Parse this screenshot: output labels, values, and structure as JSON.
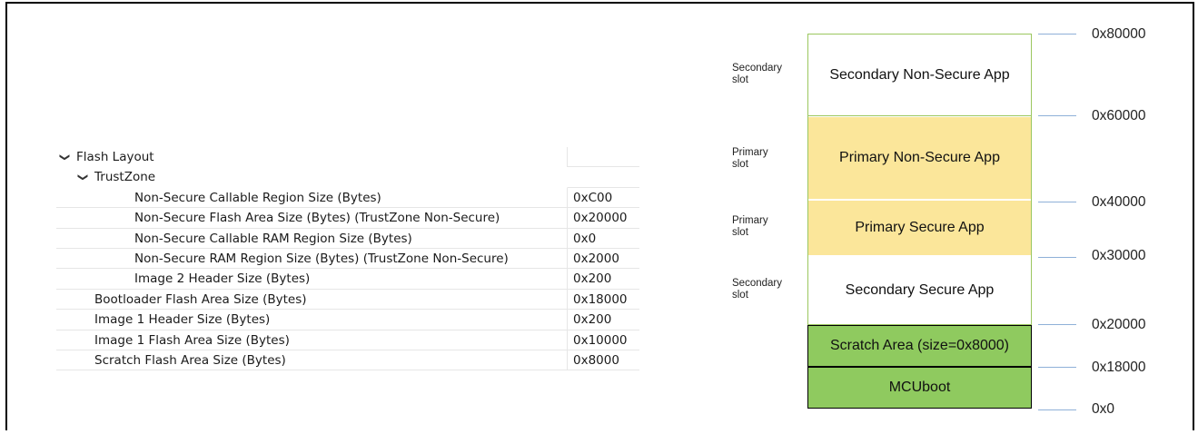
{
  "tree": {
    "flash_layout": "Flash Layout",
    "trustzone": "TrustZone",
    "rows": [
      {
        "name": "Non-Secure Callable Region Size (Bytes)",
        "value": "0xC00"
      },
      {
        "name": "Non-Secure Flash Area Size (Bytes) (TrustZone Non-Secure)",
        "value": "0x20000"
      },
      {
        "name": "Non-Secure Callable RAM Region Size (Bytes)",
        "value": "0x0"
      },
      {
        "name": "Non-Secure RAM Region Size (Bytes) (TrustZone Non-Secure)",
        "value": "0x2000"
      },
      {
        "name": "Image 2 Header Size (Bytes)",
        "value": "0x200"
      },
      {
        "name": "Bootloader Flash Area Size (Bytes)",
        "value": "0x18000"
      },
      {
        "name": "Image 1 Header Size (Bytes)",
        "value": "0x200"
      },
      {
        "name": "Image 1 Flash Area Size (Bytes)",
        "value": "0x10000"
      },
      {
        "name": "Scratch Flash Area Size (Bytes)",
        "value": "0x8000"
      }
    ]
  },
  "memory_map": {
    "blocks": [
      {
        "label": "Secondary Non-Secure App",
        "color": "#ffffff",
        "border": "#9bc75f"
      },
      {
        "label": "Primary Non-Secure App",
        "color": "#fbe69a",
        "border": "#ffffff"
      },
      {
        "label": "Primary Secure App",
        "color": "#fbe69a",
        "border": "#ffffff"
      },
      {
        "label": "Secondary Secure App",
        "color": "#ffffff",
        "border": "#ffffff"
      },
      {
        "label": "Scratch Area (size=0x8000)",
        "color": "#8fca5f",
        "border": "#000000"
      },
      {
        "label": "MCUboot",
        "color": "#8fca5f",
        "border": "#000000"
      }
    ],
    "slots": [
      {
        "label": "Secondary\nslot"
      },
      {
        "label": "Primary\nslot"
      },
      {
        "label": "Primary\nslot"
      },
      {
        "label": "Secondary\nslot"
      }
    ],
    "addresses": [
      "0x80000",
      "0x60000",
      "0x40000",
      "0x30000",
      "0x20000",
      "0x18000",
      "0x0"
    ],
    "tick_color": "#8fb0d8"
  }
}
